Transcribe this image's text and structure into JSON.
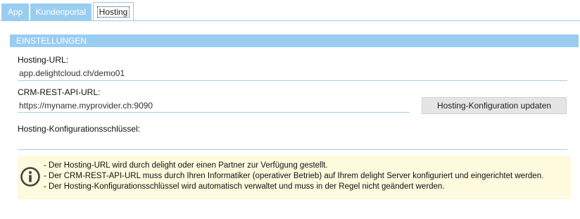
{
  "tabs": [
    {
      "label": "App"
    },
    {
      "label": "Kundenportal"
    },
    {
      "label": "Hosting"
    }
  ],
  "section": {
    "title": "EINSTELLUNGEN"
  },
  "fields": {
    "hosting_url": {
      "label": "Hosting-URL:",
      "value": "app.delightcloud.ch/demo01"
    },
    "crm_url": {
      "label": "CRM-REST-API-URL:",
      "value": "https://myname.myprovider.ch:9090"
    },
    "config_key": {
      "label": "Hosting-Konfigurationsschlüssel:",
      "value": ""
    }
  },
  "update_button": {
    "label": "Hosting-Konfiguration updaten"
  },
  "info": {
    "icon": "info-icon",
    "lines": [
      "- Der Hosting-URL wird durch delight oder einen Partner zur Verfügung gestellt.",
      "- Der CRM-REST-API-URL muss durch Ihren Informatiker (operativer Betrieb) auf Ihrem delight Server konfiguriert und eingerichtet werden.",
      "- Der Hosting-Konfigurationsschlüssel wird automatisch verwaltet und muss in der Regel nicht geändert werden."
    ]
  },
  "colors": {
    "accent": "#99cdf0",
    "info_bg": "#fdfadd",
    "button_bg": "#e5e5e5"
  }
}
